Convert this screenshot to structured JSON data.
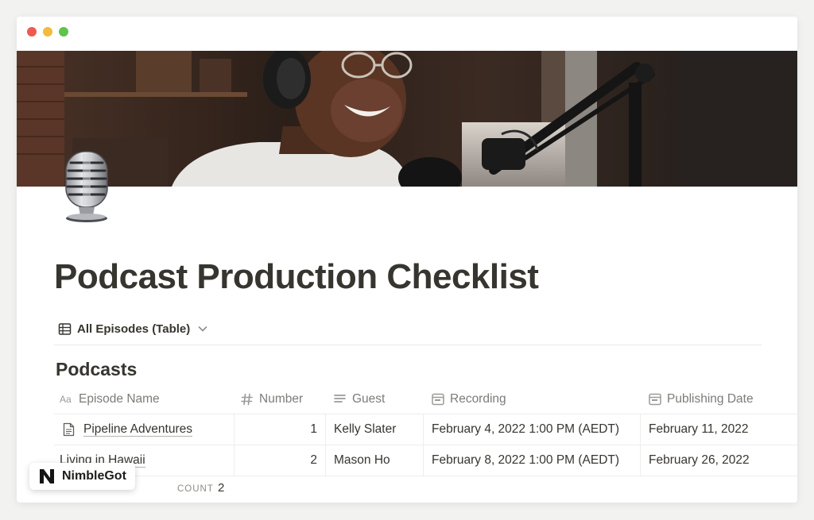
{
  "page": {
    "title": "Podcast Production Checklist",
    "view_label": "All Episodes (Table)",
    "database_title": "Podcasts"
  },
  "table": {
    "columns": [
      {
        "label": "Episode Name",
        "icon": "text-property-icon"
      },
      {
        "label": "Number",
        "icon": "hash-icon"
      },
      {
        "label": "Guest",
        "icon": "text-lines-icon"
      },
      {
        "label": "Recording",
        "icon": "calendar-icon"
      },
      {
        "label": "Publishing Date",
        "icon": "calendar-icon"
      }
    ],
    "rows": [
      {
        "name": "Pipeline Adventures",
        "number": "1",
        "guest": "Kelly Slater",
        "recording": "February 4, 2022 1:00 PM (AEDT)",
        "publishing": "February 11, 2022"
      },
      {
        "name": "Living in Hawaii",
        "number": "2",
        "guest": "Mason Ho",
        "recording": "February 8, 2022 1:00 PM (AEDT)",
        "publishing": "February 26, 2022"
      }
    ]
  },
  "footer": {
    "count_label": "COUNT",
    "count_value": "2"
  },
  "badge": {
    "name": "NimbleGot"
  },
  "colors": {
    "text": "#37352f",
    "muted": "#7d7c78",
    "divider": "#ededec",
    "traffic_red": "#ee5a52",
    "traffic_yellow": "#f2bb3d",
    "traffic_green": "#5dc44c"
  }
}
